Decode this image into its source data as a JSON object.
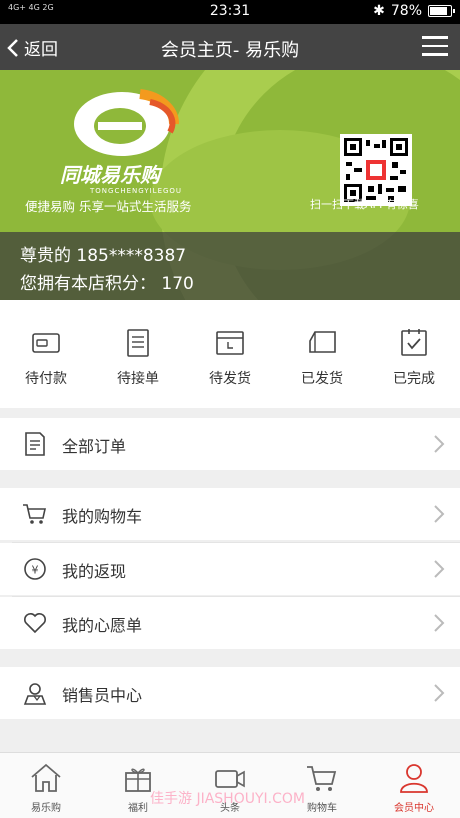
{
  "status_bar": {
    "signal": "4G+ 4G 2G",
    "time": "23:31",
    "battery": "78%",
    "battery_level": 0.78
  },
  "navbar": {
    "back_label": "返回",
    "title": "会员主页- 易乐购"
  },
  "banner": {
    "brand_name": "同城易乐购",
    "brand_en": "TONGCHENGYILEGOU",
    "slogan": "便捷易购 乐享一站式生活服务",
    "qr_caption": "扫一扫下载APP有惊喜"
  },
  "user": {
    "greeting": "尊贵的 185****8387",
    "points_text": "您拥有本店积分： 170"
  },
  "order_status": [
    {
      "label": "待付款",
      "icon": "wallet-icon"
    },
    {
      "label": "待接单",
      "icon": "clipboard-icon"
    },
    {
      "label": "待发货",
      "icon": "box-icon"
    },
    {
      "label": "已发货",
      "icon": "truck-icon"
    },
    {
      "label": "已完成",
      "icon": "check-icon"
    }
  ],
  "menu": {
    "all_orders": "全部订单",
    "cart": "我的购物车",
    "cashback": "我的返现",
    "wishlist": "我的心愿单",
    "sales_center": "销售员中心"
  },
  "tabs": [
    {
      "label": "易乐购",
      "icon": "home-icon"
    },
    {
      "label": "福利",
      "icon": "gift-icon"
    },
    {
      "label": "头条",
      "icon": "video-icon"
    },
    {
      "label": "购物车",
      "icon": "cart-icon"
    },
    {
      "label": "会员中心",
      "icon": "user-icon",
      "active": true
    }
  ],
  "colors": {
    "accent": "#d9362e",
    "banner": "#8fb83a",
    "navbar": "#444444"
  },
  "watermark": "佳手游 JIASHOUYI.COM"
}
